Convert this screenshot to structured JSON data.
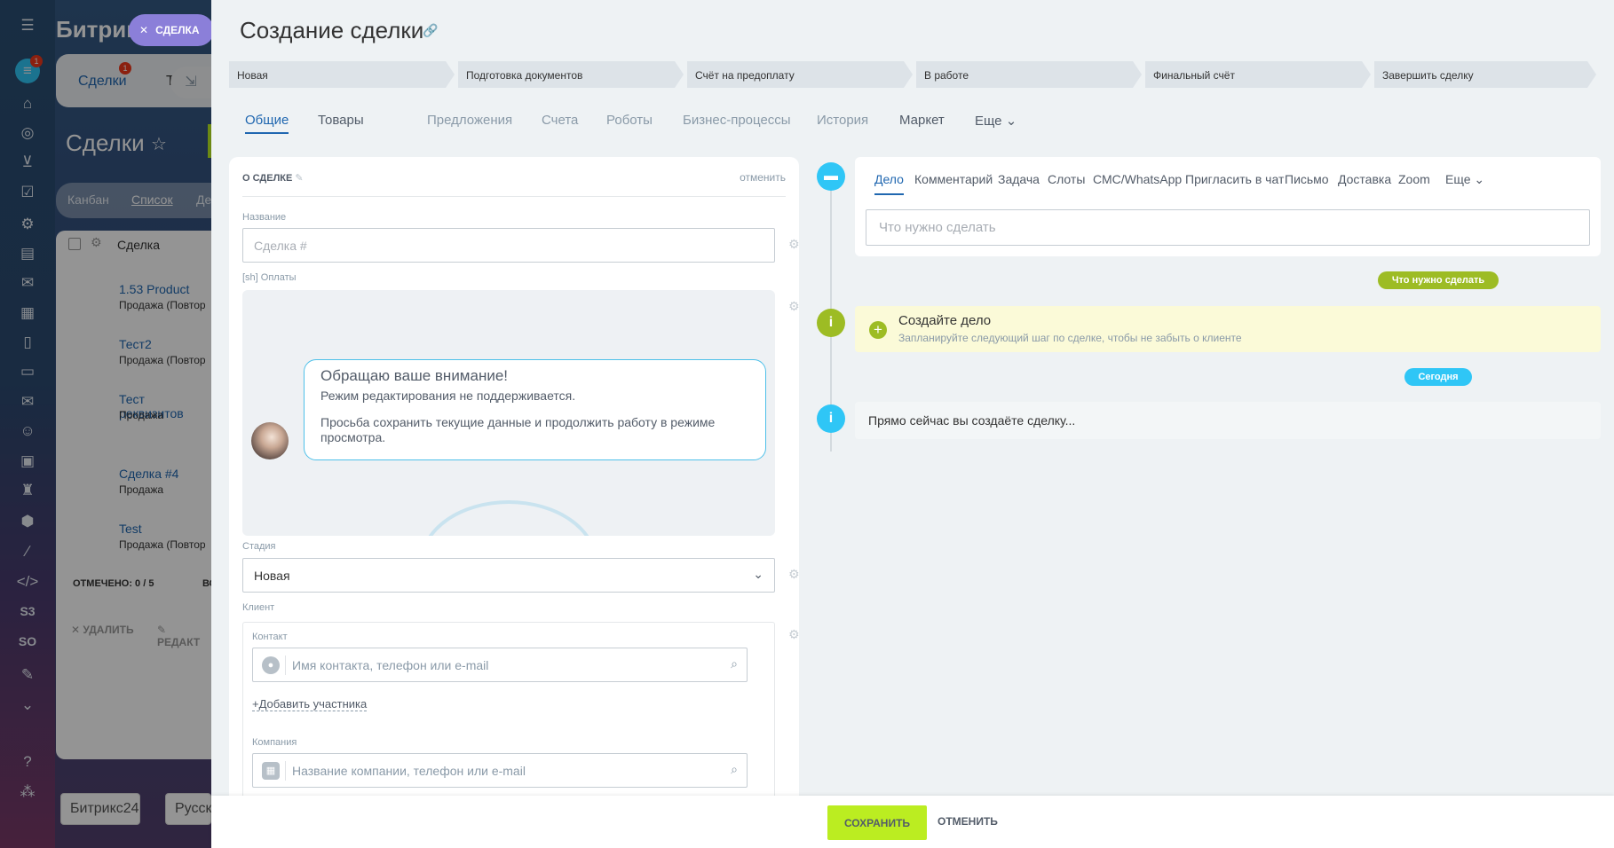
{
  "bg": {
    "logo": "Битрикс",
    "tab_deals": "Сделки",
    "tab_deals_badge": "1",
    "tab_more": "Т",
    "title": "Сделки",
    "view_kanban": "Канбан",
    "view_list": "Список",
    "view_more": "Де",
    "col_deal": "Сделка",
    "rows": [
      {
        "name": "1.53 Product",
        "sub": "Продажа (Повтор"
      },
      {
        "name": "Тест2",
        "sub": "Продажа (Повтор"
      },
      {
        "name": "Тест реквизитов",
        "sub": "Продажа"
      },
      {
        "name": "Сделка #4",
        "sub": "Продажа"
      },
      {
        "name": "Test",
        "sub": "Продажа (Повтор"
      }
    ],
    "selected": "ОТМЕЧЕНО: 0 / 5",
    "selected_more": "ВС",
    "delete": "УДАЛИТЬ",
    "edit": "РЕДАКТ",
    "footer_logo": "Битрикс24",
    "footer_lang": "Русск",
    "notif_badge": "1"
  },
  "close_chip": {
    "label": "СДЕЛКА"
  },
  "slider": {
    "title": "Создание сделки",
    "stages": [
      "Новая",
      "Подготовка документов",
      "Счёт на предоплату",
      "В работе",
      "Финальный счёт",
      "Завершить сделку"
    ],
    "tabs": [
      "Общие",
      "Товары",
      "Предложения",
      "Счета",
      "Роботы",
      "Бизнес-процессы",
      "История",
      "Маркет",
      "Еще"
    ]
  },
  "form": {
    "section_title": "О СДЕЛКЕ",
    "cancel": "отменить",
    "name_label": "Название",
    "name_placeholder": "Сделка #",
    "payments_label": "[sh] Оплаты",
    "notice_title": "Обращаю ваше внимание!",
    "notice_line1": "Режим редактирования не поддерживается.",
    "notice_line2": "Просьба сохранить текущие данные и продолжить работу в режиме просмотра.",
    "stage_label": "Стадия",
    "stage_value": "Новая",
    "client_label": "Клиент",
    "contact_label": "Контакт",
    "contact_placeholder": "Имя контакта, телефон или e-mail",
    "add_participant": "Добавить участника",
    "company_label": "Компания",
    "company_placeholder": "Название компании, телефон или e-mail"
  },
  "activity": {
    "tabs": [
      "Дело",
      "Комментарий",
      "Задача",
      "Слоты",
      "СМС/WhatsApp",
      "Пригласить в чат",
      "Письмо",
      "Доставка",
      "Zoom",
      "Еще"
    ],
    "input_placeholder": "Что нужно сделать",
    "pill_todo": "Что нужно сделать",
    "create_title": "Создайте дело",
    "create_sub": "Запланируйте следующий шаг по сделке, чтобы не забыть о клиенте",
    "pill_today": "Сегодня",
    "now_text": "Прямо сейчас вы создаёте сделку..."
  },
  "footer": {
    "save": "СОХРАНИТЬ",
    "cancel": "ОТМЕНИТЬ"
  },
  "colors": {
    "accent_blue": "#2067b0",
    "timeline_blue": "#2fc6f6",
    "timeline_green": "#9dbc24",
    "save_green": "#bbed21"
  }
}
